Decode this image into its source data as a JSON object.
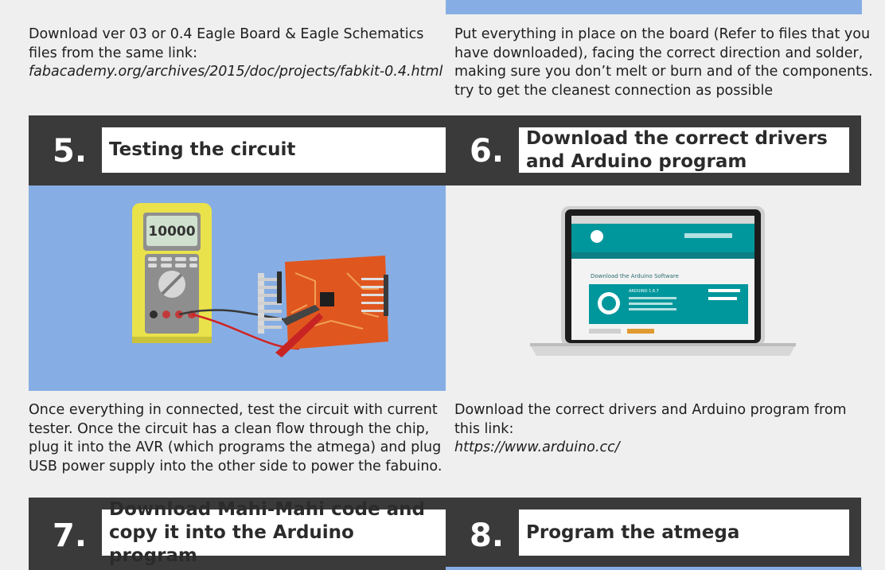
{
  "step_top_left": {
    "text": "Download ver 03 or 0.4 Eagle Board & Eagle Schematics files from the same link:",
    "link": "fabacademy.org/archives/2015/doc/projects/fabkit-0.4.html"
  },
  "step_top_right": {
    "text": "Put everything in place on the board (Refer to files that you have downloaded), facing the correct direction and solder, making sure you don’t melt or burn and of the components. try to get the cleanest connection as possible"
  },
  "step5": {
    "number": "5.",
    "title": "Testing the circuit",
    "meter_reading": "10000",
    "text": "Once everything in connected, test the circuit with current tester. Once the circuit has a clean flow through the chip, plug it into the AVR (which programs the atmega) and plug USB power supply into the other side to power the fabuino."
  },
  "step6": {
    "number": "6.",
    "title": "Download the correct drivers and Arduino program",
    "screen": {
      "page_heading": "Download the Arduino Software",
      "version": "ARDUINO 1.6.7"
    },
    "text": "Download the correct drivers and Arduino program from this link:",
    "link": "https://www.arduino.cc/"
  },
  "step7": {
    "number": "7.",
    "title": "Download Mahi-Mahi code and copy it into the Arduino program"
  },
  "step8": {
    "number": "8.",
    "title": "Program the atmega"
  },
  "colors": {
    "band": "#3a3a3a",
    "image_blue": "#86aee4",
    "background": "#efefef",
    "meter_yellow": "#e6e14a",
    "board_orange": "#e0561f",
    "arduino_teal": "#00979c"
  }
}
